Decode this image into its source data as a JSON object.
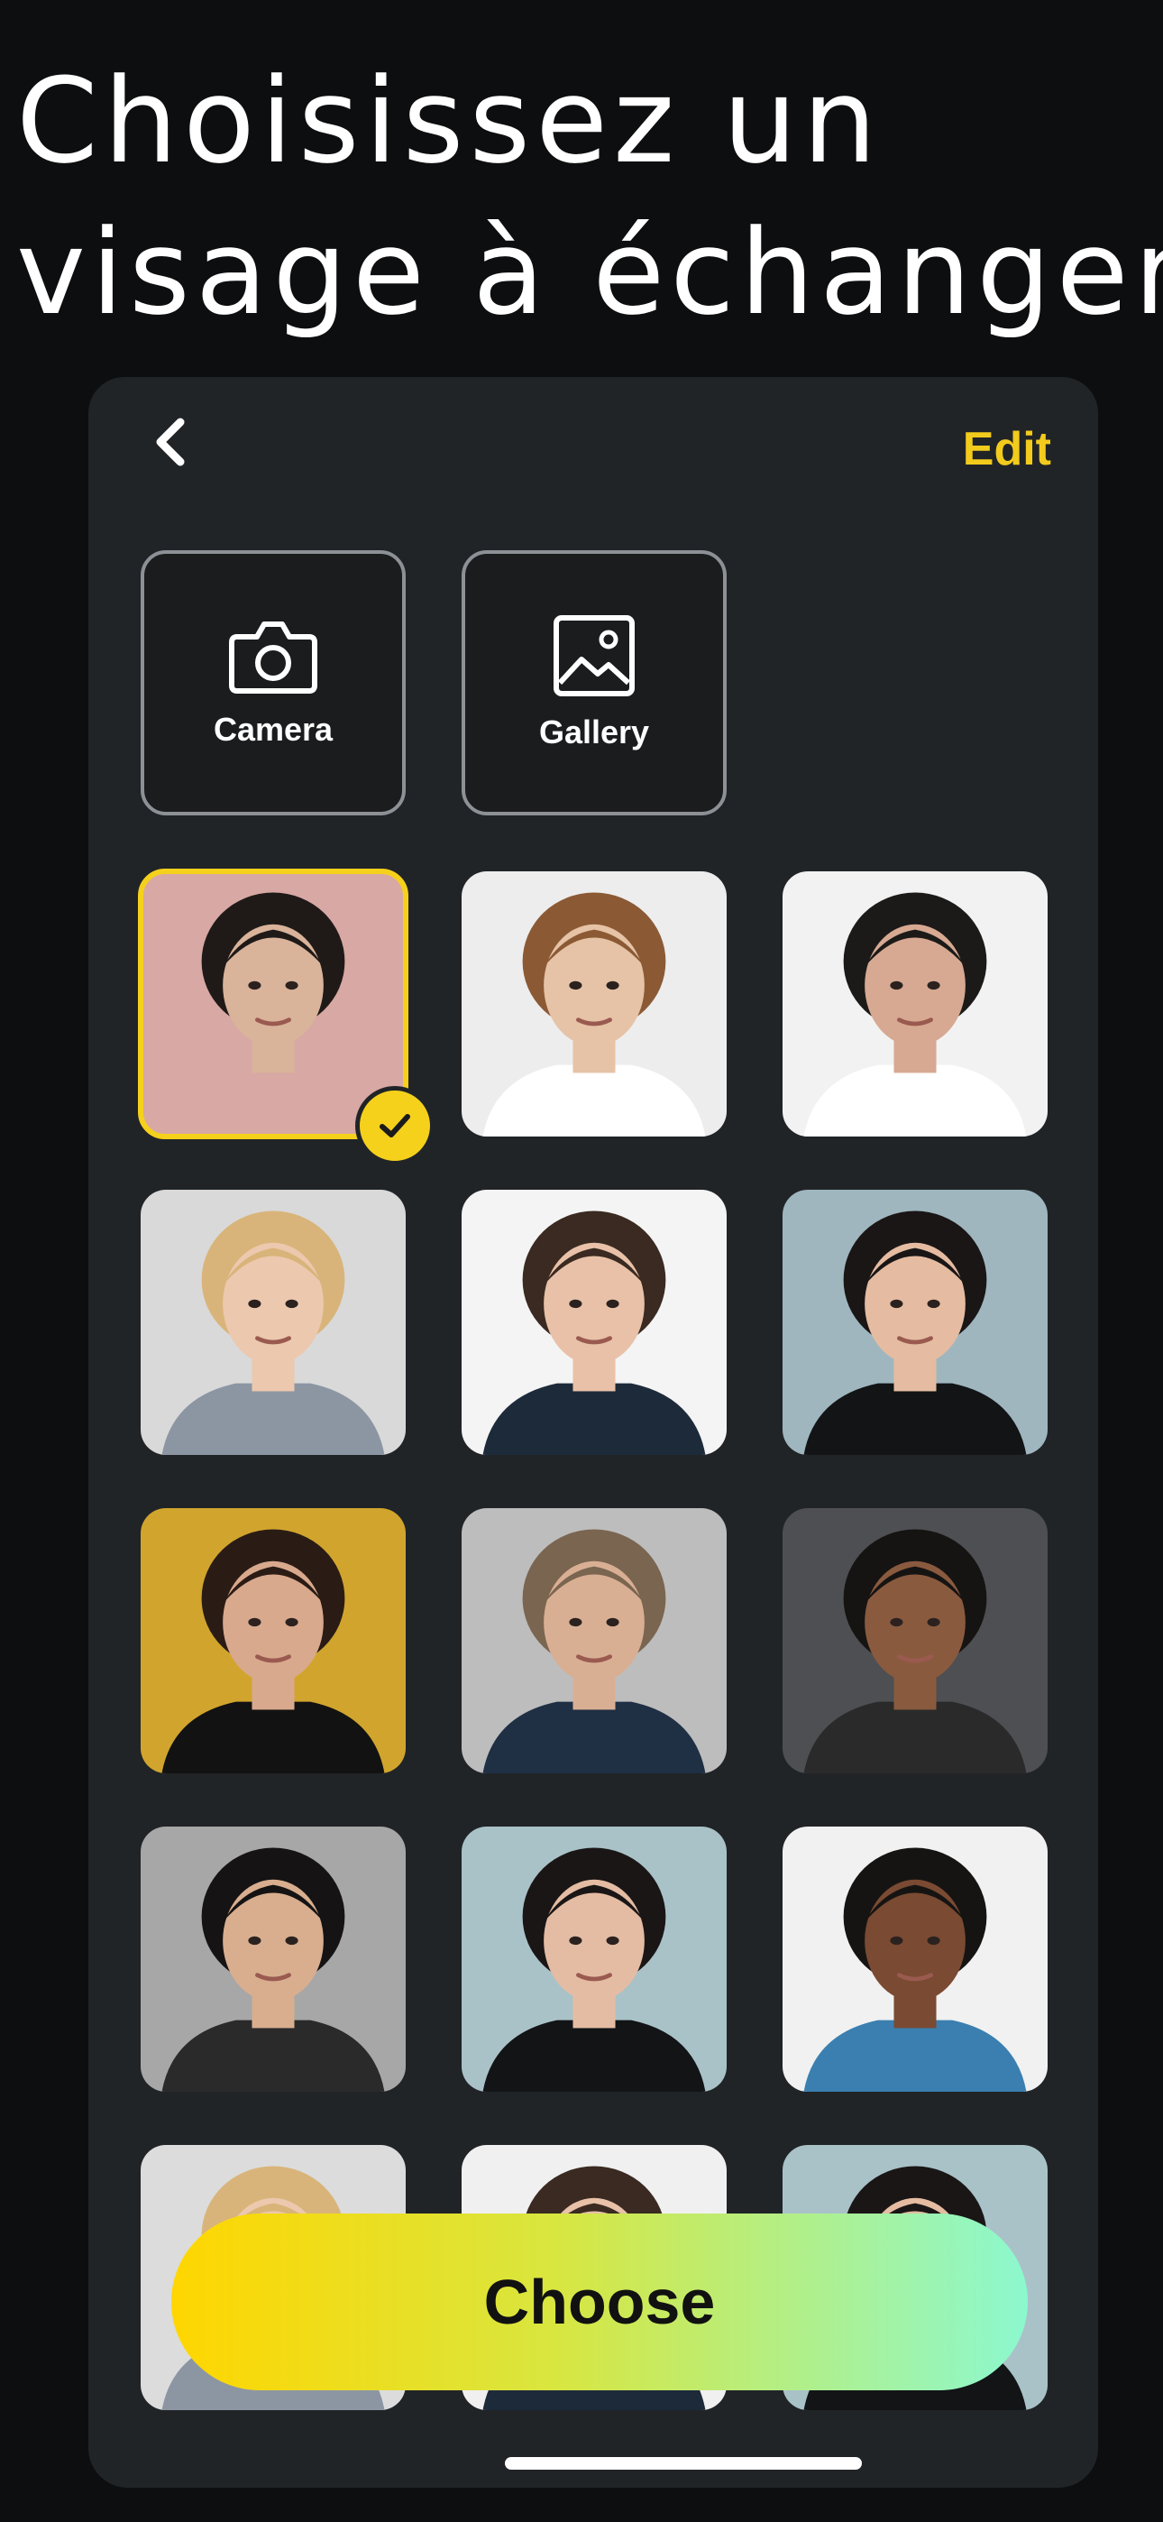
{
  "headline": {
    "line1": "Choisissez un",
    "line2": "visage à échanger"
  },
  "header": {
    "back_icon": "chevron-left-icon",
    "edit_label": "Edit"
  },
  "sources": [
    {
      "label": "Camera",
      "icon": "camera-icon"
    },
    {
      "label": "Gallery",
      "icon": "image-icon"
    }
  ],
  "faces": [
    {
      "bg": "#d8a8a4",
      "skin": "#d9b39a",
      "hair": "#1f1a18",
      "shirt": "#d8a8a4",
      "selected": true
    },
    {
      "bg": "#ededed",
      "skin": "#e6c3a6",
      "hair": "#8b5a35",
      "shirt": "#ffffff",
      "selected": false
    },
    {
      "bg": "#f2f2f2",
      "skin": "#d7a992",
      "hair": "#1c1a19",
      "shirt": "#ffffff",
      "selected": false
    },
    {
      "bg": "#d9d9d9",
      "skin": "#ecc8ae",
      "hair": "#d9b47a",
      "shirt": "#8c96a3",
      "selected": false
    },
    {
      "bg": "#f4f4f4",
      "skin": "#e8c1a8",
      "hair": "#3a2a21",
      "shirt": "#1d2a3a",
      "selected": false
    },
    {
      "bg": "#9fb6bf",
      "skin": "#e5bca1",
      "hair": "#1a1616",
      "shirt": "#121416",
      "selected": false
    },
    {
      "bg": "#d1a52d",
      "skin": "#d9a98d",
      "hair": "#2a1c15",
      "shirt": "#121212",
      "selected": false
    },
    {
      "bg": "#bdbdbd",
      "skin": "#d9af94",
      "hair": "#7a6550",
      "shirt": "#1f2f44",
      "selected": false
    },
    {
      "bg": "#4d4f52",
      "skin": "#8a5a3f",
      "hair": "#161413",
      "shirt": "#2a2a2a",
      "selected": false
    },
    {
      "bg": "#a7a7a7",
      "skin": "#d8ae8f",
      "hair": "#151313",
      "shirt": "#2a2a2a",
      "selected": false
    },
    {
      "bg": "#a9c2c8",
      "skin": "#e4bca3",
      "hair": "#1a1616",
      "shirt": "#121416",
      "selected": false
    },
    {
      "bg": "#f1f1f1",
      "skin": "#7a4a32",
      "hair": "#161413",
      "shirt": "#3a7fb0",
      "selected": false
    },
    {
      "bg": "#dcdcdc",
      "skin": "#ecc8ae",
      "hair": "#d9b47a",
      "shirt": "#8c96a3",
      "selected": false
    },
    {
      "bg": "#f0f0f0",
      "skin": "#e8c1a8",
      "hair": "#3a2a21",
      "shirt": "#1d2a3a",
      "selected": false
    },
    {
      "bg": "#a9c2c8",
      "skin": "#e5bca1",
      "hair": "#1a1616",
      "shirt": "#121416",
      "selected": false
    }
  ],
  "actions": {
    "choose_label": "Choose"
  },
  "colors": {
    "accent": "#f5d11c",
    "background": "#212427",
    "gradient_start": "#ffd600",
    "gradient_end": "#8cf8cf"
  }
}
